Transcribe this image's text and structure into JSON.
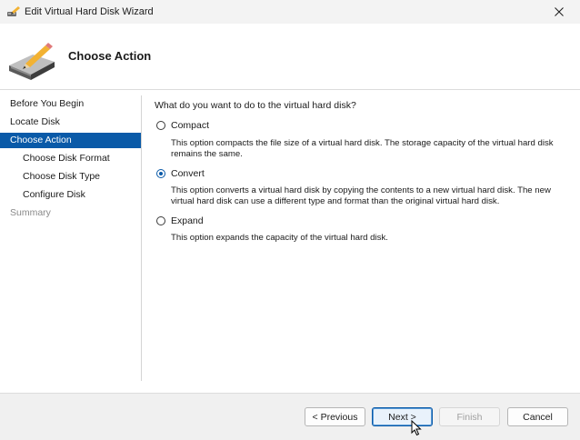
{
  "window": {
    "title": "Edit Virtual Hard Disk Wizard",
    "app_icon": "disk-pencil-icon",
    "close_icon": "close-icon"
  },
  "header": {
    "icon": "disk-pencil-icon",
    "title": "Choose Action"
  },
  "nav": {
    "items": [
      {
        "label": "Before You Begin",
        "state": "normal"
      },
      {
        "label": "Locate Disk",
        "state": "normal"
      },
      {
        "label": "Choose Action",
        "state": "active"
      },
      {
        "label": "Choose Disk Format",
        "state": "normal"
      },
      {
        "label": "Choose Disk Type",
        "state": "normal"
      },
      {
        "label": "Configure Disk",
        "state": "normal"
      },
      {
        "label": "Summary",
        "state": "disabled"
      }
    ]
  },
  "content": {
    "question": "What do you want to do to the virtual hard disk?",
    "options": [
      {
        "label": "Compact",
        "checked": false,
        "description": "This option compacts the file size of a virtual hard disk. The storage capacity of the virtual hard disk remains the same."
      },
      {
        "label": "Convert",
        "checked": true,
        "description": "This option converts a virtual hard disk by copying the contents to a new virtual hard disk. The new virtual hard disk can use a different type and format than the original virtual hard disk."
      },
      {
        "label": "Expand",
        "checked": false,
        "description": "This option expands the capacity of the virtual hard disk."
      }
    ]
  },
  "footer": {
    "previous_label": "< Previous",
    "next_label": "Next >",
    "finish_label": "Finish",
    "cancel_label": "Cancel"
  },
  "colors": {
    "accent": "#0a5aa8",
    "active_nav_text": "#ffffff",
    "disabled_text": "#8a8a8a"
  }
}
